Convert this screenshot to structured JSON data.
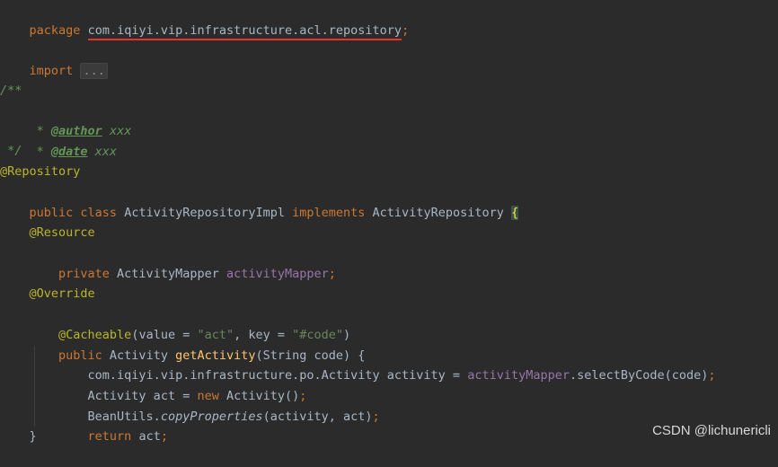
{
  "lines": {
    "l1": {
      "kw": "package",
      "pkg": "com.iqiyi.vip.infrastructure.acl.repository",
      "semi": ";"
    },
    "l2": {
      "kw": "import",
      "fold": "..."
    },
    "l3": {
      "text": "/**"
    },
    "l4": {
      "star": " * ",
      "tag": "@author",
      "val": " xxx"
    },
    "l5": {
      "star": " * ",
      "tag": "@date",
      "val": " xxx"
    },
    "l6": {
      "text": " */"
    },
    "l7": {
      "text": "@Repository"
    },
    "l8": {
      "kw1": "public class",
      "name": " ActivityRepositoryImpl ",
      "kw2": "implements",
      "iface": " ActivityRepository ",
      "brace": "{"
    },
    "l9": {
      "text": "    @Resource"
    },
    "l10": {
      "kw": "    private",
      "type": " ActivityMapper ",
      "field": "activityMapper",
      "semi": ";"
    },
    "l11": {
      "text": "    @Override"
    },
    "l12": {
      "ann": "    @Cacheable",
      "p1": "(value = ",
      "s1": "\"act\"",
      "p2": ", key = ",
      "s2": "\"#code\"",
      "p3": ")"
    },
    "l13": {
      "kw": "    public",
      "type": " Activity ",
      "method": "getActivity",
      "rest": "(String code) {"
    },
    "l14": {
      "a": "        com.iqiyi.vip.infrastructure.po.Activity activity = ",
      "field": "activityMapper",
      "b": ".selectByCode(code)",
      "semi": ";"
    },
    "l15": {
      "a": "        Activity act = ",
      "kw": "new",
      "b": " Activity()",
      "semi": ";"
    },
    "l16": {
      "a": "        BeanUtils.",
      "static": "copyProperties",
      "b": "(activity, act)",
      "semi": ";"
    },
    "l17": {
      "kw": "        return",
      "b": " act",
      "semi": ";"
    },
    "l18": {
      "text": "    }"
    }
  },
  "watermark": "CSDN @lichunericli",
  "colors": {
    "background": "#2b2b2b",
    "keyword": "#cc7832",
    "annotation": "#bbb529",
    "comment": "#629755",
    "field": "#9876aa",
    "string": "#6a8759",
    "method": "#ffc66d",
    "text": "#a9b7c6",
    "underline": "#e8322e"
  }
}
